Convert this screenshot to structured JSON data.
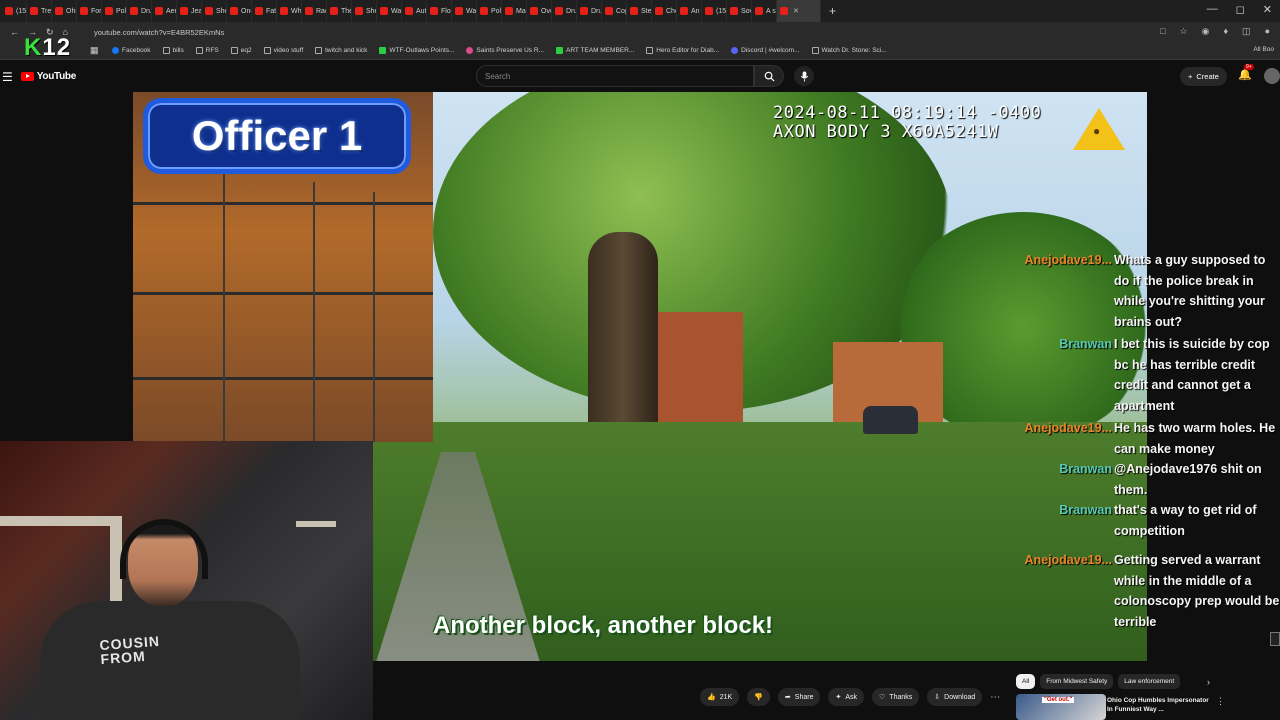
{
  "browser": {
    "tabs": [
      "(15)",
      "Tren",
      "Ohi",
      "Fort",
      "Poli",
      "Drui",
      "Aere",
      "Jeal",
      "She",
      "One",
      "Fath",
      "Whe",
      "Raci",
      "The",
      "She",
      "Wan",
      "Auti",
      "Flori",
      "Wan",
      "Poli",
      "Man",
      "Ove",
      "Drui",
      "Drui",
      "Cop",
      "Stea",
      "Chel",
      "An",
      "(15)",
      "Sove",
      "A si"
    ],
    "active_tab": "",
    "url": "youtube.com/watch?v=E4BR52EKmNs",
    "bookmarks": [
      "Facebook",
      "bills",
      "RFS",
      "eq2",
      "video stuff",
      "twitch and kick",
      "WTF-Outlaws Points...",
      "Saints Preserve Us R...",
      "ART TEAM MEMBER...",
      "Hero Editor for Diab...",
      "Discord | #welcom...",
      "Watch Dr. Stone: Sci..."
    ],
    "all_bookmarks": "All Boo",
    "overlay_logo": {
      "k": "K",
      "num": "12"
    }
  },
  "youtube": {
    "logo_text": "YouTube",
    "search_placeholder": "Search",
    "create_label": "Create",
    "notif_badge": "9+"
  },
  "video": {
    "officer_label": "Officer 1",
    "timestamp": "2024-08-11 08:19:14 -0400",
    "device": "AXON BODY 3 X60A5241W",
    "subtitle": "Another block, another block!"
  },
  "webcam": {
    "shirt_line1": "COUSIN",
    "shirt_line2": "FROM"
  },
  "chat": [
    {
      "user": "Anejodave19...",
      "text": "Whats a guy supposed to do if the police break in while you're shitting your brains out?",
      "color": "orange"
    },
    {
      "user": "Branwan",
      "text": "I bet this is suicide by cop bc he has terrible credit credit and cannot get a apartment",
      "color": "teal"
    },
    {
      "user": "Anejodave19...",
      "text": "He has two warm holes. He can make money",
      "color": "orange"
    },
    {
      "user": "Branwan",
      "text": "@Anejodave1976 shit on them.",
      "color": "teal"
    },
    {
      "user": "Branwan",
      "text": "that's a way to get rid of competition",
      "color": "teal"
    },
    {
      "user": "Anejodave19...",
      "text": "Getting served a warrant while in the middle of a colonoscopy prep would be terrible",
      "color": "orange"
    }
  ],
  "actions": {
    "likes": "21K",
    "share": "Share",
    "ask": "Ask",
    "thanks": "Thanks",
    "download": "Download"
  },
  "chips": [
    "All",
    "From Midwest Safety",
    "Law enforcement"
  ],
  "recommendation": {
    "title": "Ohio Cop Humbles Impersonator In Funniest Way ...",
    "thumb_text": "\"Get out.\""
  }
}
